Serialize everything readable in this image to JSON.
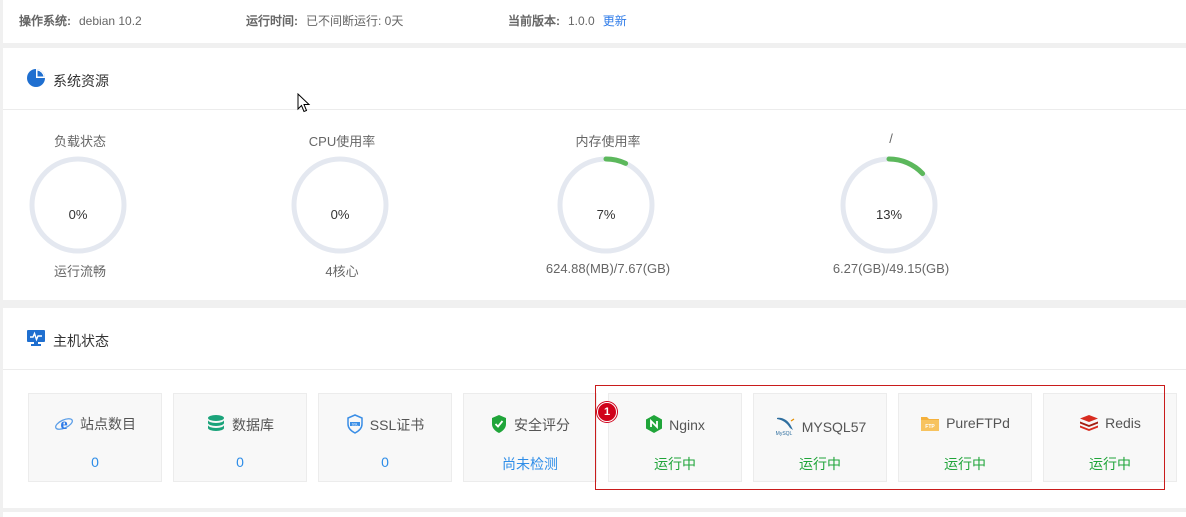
{
  "system_info": {
    "os_label": "操作系统:",
    "os_value": "debian 10.2",
    "uptime_label": "运行时间:",
    "uptime_value": "已不间断运行: 0天",
    "version_label": "当前版本:",
    "version_value": "1.0.0",
    "update_link": "更新"
  },
  "resources": {
    "title": "系统资源",
    "icon": "pie-chart-icon",
    "gauges": [
      {
        "title": "负载状态",
        "value_text": "0%",
        "percent": 0,
        "subtitle": "运行流畅",
        "color": "#20a53a"
      },
      {
        "title": "CPU使用率",
        "value_text": "0%",
        "percent": 0,
        "subtitle": "4核心",
        "color": "#20a53a"
      },
      {
        "title": "内存使用率",
        "value_text": "7%",
        "percent": 7,
        "subtitle": "624.88(MB)/7.67(GB)",
        "color": "#5cb85c"
      },
      {
        "title": "/",
        "value_text": "13%",
        "percent": 13,
        "subtitle": "6.27(GB)/49.15(GB)",
        "color": "#5cb85c"
      }
    ],
    "track_color": "#e4e8f0"
  },
  "host": {
    "title": "主机状态",
    "icon": "monitor-icon",
    "cards": [
      {
        "label": "站点数目",
        "value": "0",
        "icon": "ie-icon"
      },
      {
        "label": "数据库",
        "value": "0",
        "icon": "database-icon"
      },
      {
        "label": "SSL证书",
        "value": "0",
        "icon": "ssl-icon"
      },
      {
        "label": "安全评分",
        "value": "尚未检测",
        "icon": "shield-check-icon"
      },
      {
        "label": "Nginx",
        "value": "运行中",
        "icon": "nginx-icon"
      },
      {
        "label": "MYSQL57",
        "value": "运行中",
        "icon": "mysql-icon"
      },
      {
        "label": "PureFTPd",
        "value": "运行中",
        "icon": "ftp-icon"
      },
      {
        "label": "Redis",
        "value": "运行中",
        "icon": "redis-icon"
      }
    ],
    "highlight_badge": "1",
    "running_color": "#20a53a",
    "link_color": "#2e8de8"
  }
}
